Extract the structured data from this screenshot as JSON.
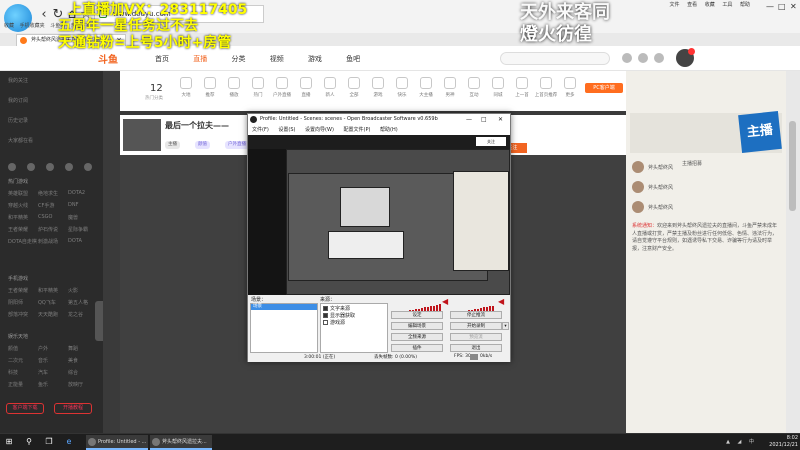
{
  "browser": {
    "address": "www.douyu.com",
    "bookmarks": [
      "收藏",
      "手机收藏夹",
      "斗鱼网",
      "热播下载"
    ],
    "tab_title": "斧头帮终风遗拉夫直播间 - 斗鱼",
    "topbar_links": [
      "文件",
      "查看",
      "收藏",
      "工具",
      "帮助"
    ]
  },
  "overlay": {
    "line1": "上直播加VX：283117405",
    "line2": "五周年一星任务过不去",
    "line3": "天通钻粉=上号5小时+房管",
    "line4": "天外来客同",
    "line5": "燈火彷徨"
  },
  "site": {
    "logo": "斗鱼",
    "nav": [
      "首页",
      "直播",
      "分类",
      "视频",
      "游戏",
      "鱼吧"
    ],
    "active_nav": "直播"
  },
  "sidebar": {
    "items": [
      "我的关注",
      "我的订阅",
      "历史记录",
      "大家都在看"
    ],
    "section_live": "热门游戏",
    "games": [
      [
        "英雄联盟",
        "绝地求生",
        "DOTA2"
      ],
      [
        "穿越火线",
        "CF手游",
        "DNF"
      ],
      [
        "和平精英",
        "CSGO",
        "魔兽"
      ],
      [
        "王者荣耀",
        "炉石传说",
        "星际争霸"
      ],
      [
        "DOTA自走棋",
        "刺激战场",
        "DOTA"
      ]
    ],
    "section_mobile": "手机游戏",
    "mobile": [
      [
        "王者荣耀",
        "和平精英",
        "火影"
      ],
      [
        "阴阳师",
        "QQ飞车",
        "第五人格"
      ],
      [
        "部落冲突",
        "天天酷跑",
        "龙之谷"
      ]
    ],
    "section_ent": "娱乐天地",
    "ent": [
      [
        "颜值",
        "户外",
        "舞蹈"
      ],
      [
        "二次元",
        "音乐",
        "美食"
      ],
      [
        "科技",
        "汽车",
        "综合"
      ],
      [
        "正能量",
        "鱼乐",
        "放映厅"
      ]
    ],
    "btn_left": "客户端下载",
    "btn_right": "开播教程"
  },
  "category_bar": {
    "count": "12",
    "count_label": "热门分类",
    "items": [
      "大地",
      "推荐",
      "播放",
      "热门",
      "户外直播",
      "直播",
      "新人",
      "全部",
      "游戏",
      "快乐",
      "大主播",
      "男神",
      "互动",
      "同城",
      "上一首",
      "上首页推荐",
      "更多"
    ],
    "pc_button": "PC客户端"
  },
  "room": {
    "title": "最后一个拉夫——",
    "tags": [
      "主播",
      "颜值",
      "户外直播"
    ],
    "follow": "关注 1关注"
  },
  "right_panel": {
    "tag": "主播招募",
    "fans": [
      "斧头帮终风",
      "斧头帮终风",
      "斧头帮终风"
    ],
    "notice_label": "系统通知：",
    "notice": "欢迎来到斧头帮终风遗拉夫的直播间，斗鱼严禁未成年人直播或打赏，严禁主播及粉丝进行任何低俗、色情、违法行为，请自觉遵守平台规则，如遇诱导私下交易、诈骗等行为请及时举报，注意财产安全。"
  },
  "obs": {
    "title": "Profile: Untitled - Scenes: scenes - Open Broadcaster Software v0.659b",
    "menu": [
      "文件(F)",
      "设置(S)",
      "设置向导(W)",
      "配置文件(P)",
      "帮助(H)"
    ],
    "scenes_label": "场景：",
    "scene_item": "场景",
    "sources_label": "来源：",
    "sources": [
      {
        "name": "文字来源",
        "checked": true
      },
      {
        "name": "显示器获取",
        "checked": true
      },
      {
        "name": "游戏源",
        "checked": false
      }
    ],
    "buttons": [
      "设定",
      "停止推流",
      "编辑场景",
      "开始录制",
      "全频来源",
      "预览流",
      "插件",
      "退出"
    ],
    "status_time": "3:00:01 (正在)",
    "status_dropped": "丢失帧数: 0 (0.00%)",
    "status_fps": "FPS: 30",
    "status_kbps": "0kb/s"
  },
  "taskbar": {
    "apps": [
      "Profile: Untitled - ...",
      "斧头帮终风遗拉夫..."
    ],
    "time": "8:02",
    "date": "2021/12/21"
  }
}
